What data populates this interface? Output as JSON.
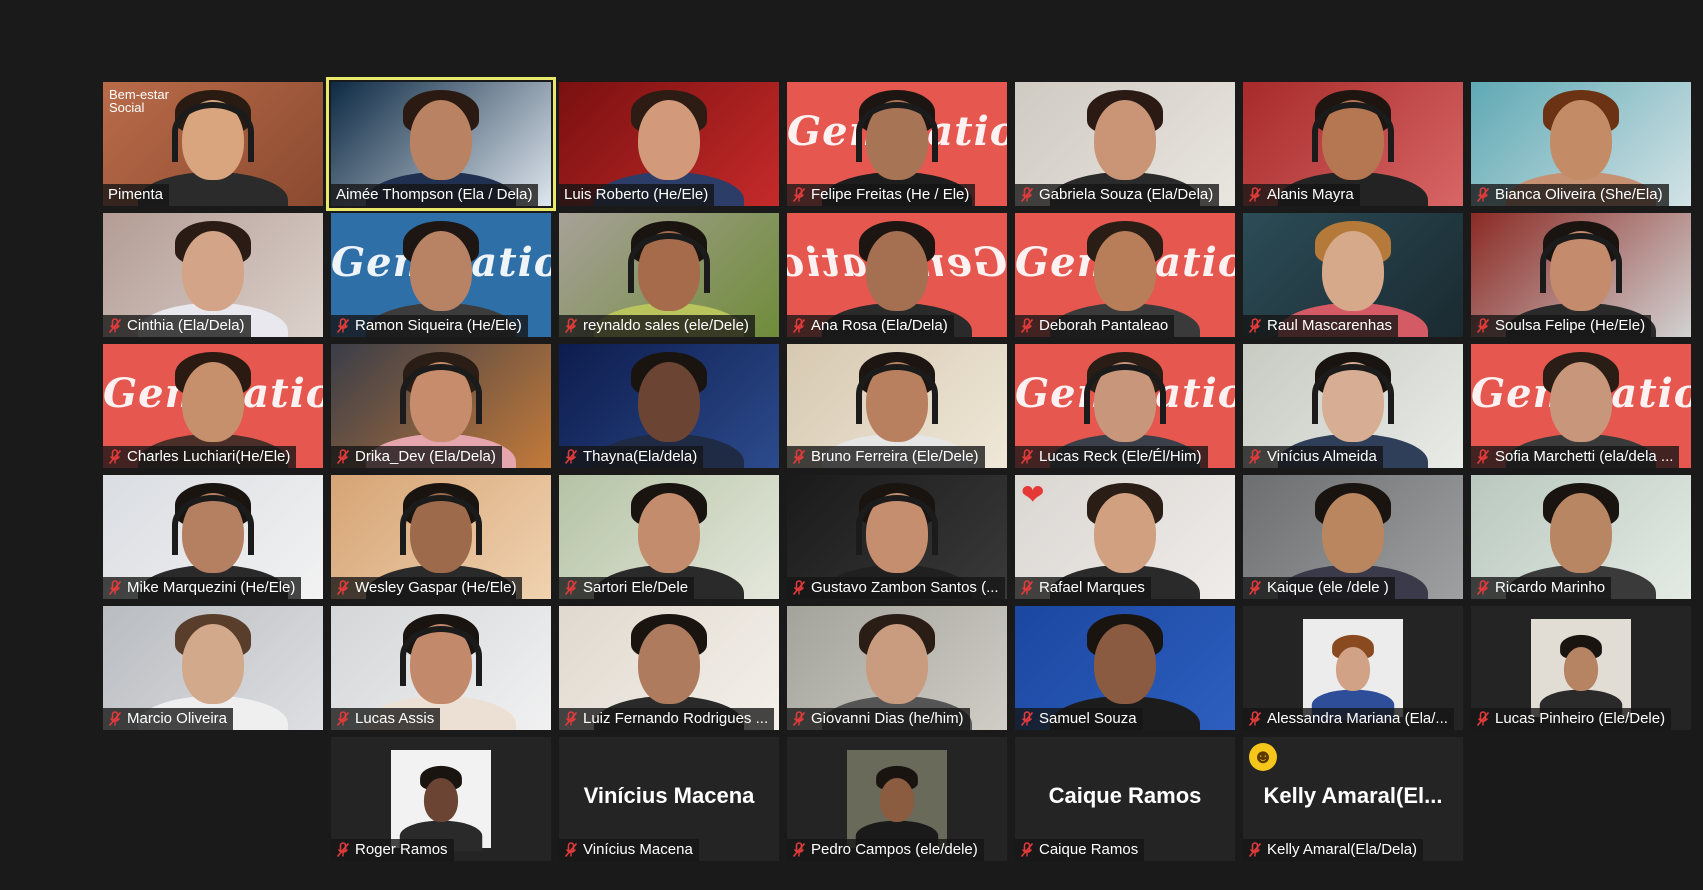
{
  "colors": {
    "background": "#1a1a1a",
    "tile_empty": "#242424",
    "active_speaker": "#e8e86a",
    "muted_icon": "#e03b3b"
  },
  "brand_text": "Generation",
  "rows": [
    [
      {
        "name": "Pimenta",
        "muted": false,
        "overlay_text": "Bem-estar Social",
        "bg": "#b96b49",
        "accent": "#8b4a30",
        "skin": "#d8a57f",
        "hair": "#2a1b12",
        "shirt": "#2b2b2b",
        "headset": true
      },
      {
        "name": "Aimée Thompson (Ela / Dela)",
        "muted": false,
        "active": true,
        "bg": "#0d2a44",
        "accent": "#dfe6ee",
        "skin": "#b98262",
        "hair": "#2a1a12",
        "shirt": "#203050"
      },
      {
        "name": "Luis Roberto (He/Ele)",
        "muted": false,
        "bg": "#7a1010",
        "accent": "#c62a2a",
        "skin": "#d29a7b",
        "hair": "#2c1c14",
        "shirt": "#2c3d68"
      },
      {
        "name": "Felipe Freitas (He / Ele)",
        "muted": true,
        "bg": "#e5574f",
        "brand": true,
        "skin": "#a87456",
        "hair": "#1d1511",
        "shirt": "#1d1d1d",
        "headset": true
      },
      {
        "name": "Gabriela Souza (Ela/Dela)",
        "muted": true,
        "bg": "#cfcac2",
        "accent": "#e9e6e0",
        "skin": "#c99576",
        "hair": "#2b1a13",
        "shirt": "#2a2a2a"
      },
      {
        "name": "Alanis Mayra",
        "muted": true,
        "bg": "#a82a2a",
        "accent": "#d86666",
        "skin": "#b57652",
        "hair": "#1e1410",
        "shirt": "#232323",
        "headset": true
      },
      {
        "name": "Bianca Oliveira (She/Ela)",
        "muted": true,
        "bg": "#5fa9b4",
        "accent": "#d3e3e6",
        "skin": "#c38c66",
        "hair": "#6b3214",
        "shirt": "#c69072"
      }
    ],
    [
      {
        "name": "Cinthia (Ela/Dela)",
        "muted": true,
        "bg": "#b39c94",
        "accent": "#dcd2cc",
        "skin": "#d3a487",
        "hair": "#2a1b14",
        "shirt": "#e8e8ee"
      },
      {
        "name": "Ramon Siqueira (He/Ele)",
        "muted": true,
        "bg": "#2e6fa8",
        "brand": true,
        "skin": "#b88364",
        "hair": "#1d1612",
        "shirt": "#3c3c3c"
      },
      {
        "name": "reynaldo sales (ele/Dele)",
        "muted": true,
        "bg": "#a7a198",
        "accent": "#6f8c39",
        "skin": "#a56b4b",
        "hair": "#1a1410",
        "shirt": "#b9c45c",
        "headset": true
      },
      {
        "name": "Ana Rosa (Ela/Dela)",
        "muted": true,
        "bg": "#e5574f",
        "brand": true,
        "mirror": true,
        "skin": "#a57052",
        "hair": "#1d1511",
        "shirt": "#2a2a2a"
      },
      {
        "name": "Deborah Pantaleao",
        "muted": true,
        "bg": "#e5574f",
        "brand": true,
        "skin": "#b87e5a",
        "hair": "#2a1d15",
        "shirt": "#3a3a3a"
      },
      {
        "name": "Raul Mascarenhas",
        "muted": true,
        "bg": "#2c4c57",
        "accent": "#1a2a30",
        "skin": "#d6a98a",
        "hair": "#b57a3a",
        "shirt": "#d45a66"
      },
      {
        "name": "Soulsa Felipe (He/Ele)",
        "muted": true,
        "bg": "#8b2a24",
        "accent": "#d2d2d2",
        "skin": "#c48b6c",
        "hair": "#1a1410",
        "shirt": "#2a2a2a",
        "headset": true
      }
    ],
    [
      {
        "name": "Charles Luchiari(He/Ele)",
        "muted": true,
        "bg": "#e5574f",
        "brand": true,
        "skin": "#c7906c",
        "hair": "#2a1a12",
        "shirt": "#4a2e28"
      },
      {
        "name": "Drika_Dev (Ela/Dela)",
        "muted": true,
        "bg": "#3a3d48",
        "accent": "#c37a3a",
        "skin": "#c68c6c",
        "hair": "#2a1d15",
        "shirt": "#e4a5ac",
        "headset": true
      },
      {
        "name": "Thayna(Ela/dela)",
        "muted": true,
        "bg": "#0d1c4d",
        "accent": "#2c4b8c",
        "skin": "#6b4434",
        "hair": "#1a1410",
        "shirt": "#1f2a44"
      },
      {
        "name": "Bruno Ferreira (Ele/Dele)",
        "muted": true,
        "bg": "#d7c9b1",
        "accent": "#efe7d8",
        "skin": "#b98060",
        "hair": "#1d1511",
        "shirt": "#e6e6e6",
        "headset": true
      },
      {
        "name": "Lucas Reck (Ele/Él/Him)",
        "muted": true,
        "bg": "#e5574f",
        "brand": true,
        "skin": "#c8967a",
        "hair": "#2a1d15",
        "shirt": "#3a3f4a",
        "headset": true
      },
      {
        "name": "Vinícius Almeida",
        "muted": true,
        "bg": "#c7cbc2",
        "accent": "#e9ebe7",
        "skin": "#d7ae94",
        "hair": "#1a1410",
        "shirt": "#2f3f5a",
        "headset": true
      },
      {
        "name": "Sofia Marchetti (ela/dela ...",
        "muted": true,
        "bg": "#e5574f",
        "brand": true,
        "skin": "#c8967a",
        "hair": "#2a1d15",
        "shirt": "#3a3a3a"
      }
    ],
    [
      {
        "name": "Mike Marquezini (He/Ele)",
        "muted": true,
        "bg": "#dadde2",
        "accent": "#f2f2f2",
        "skin": "#b58061",
        "hair": "#1a1410",
        "shirt": "#2a2a2a",
        "headset": true
      },
      {
        "name": "Wesley Gaspar (He/Ele)",
        "muted": true,
        "bg": "#d6a475",
        "accent": "#f0d2b0",
        "skin": "#9e6a4c",
        "hair": "#1a1410",
        "shirt": "#2a2a2a",
        "headset": true
      },
      {
        "name": "Sartori Ele/Dele",
        "muted": true,
        "bg": "#b5c3a5",
        "accent": "#e4e8dc",
        "skin": "#c38c6c",
        "hair": "#1a1410",
        "shirt": "#2a2a2a"
      },
      {
        "name": "Gustavo Zambon Santos (...",
        "muted": true,
        "bg": "#1a1a1a",
        "accent": "#3a3a3a",
        "skin": "#c58e6e",
        "hair": "#1a1410",
        "shirt": "#202020",
        "headset": true
      },
      {
        "name": "Rafael Marques",
        "muted": true,
        "reaction": "heart",
        "reaction_glyph": "❤",
        "bg": "#dad6d2",
        "accent": "#efece9",
        "skin": "#d1a081",
        "hair": "#2a1d15",
        "shirt": "#2a2a2a"
      },
      {
        "name": "Kaique (ele /dele )",
        "muted": true,
        "bg": "#6c6e70",
        "accent": "#9ea0a2",
        "skin": "#b9865f",
        "hair": "#1a1410",
        "shirt": "#3a3a4a"
      },
      {
        "name": "Ricardo Marinho",
        "muted": true,
        "bg": "#b9c8be",
        "accent": "#e4ebe5",
        "skin": "#b98664",
        "hair": "#1a1410",
        "shirt": "#3a3a3a"
      }
    ],
    [
      {
        "name": "Marcio Oliveira",
        "muted": true,
        "bg": "#b9bcc0",
        "accent": "#dedfe2",
        "skin": "#d3a98c",
        "hair": "#5a3e2c",
        "shirt": "#efefef"
      },
      {
        "name": "Lucas Assis",
        "muted": true,
        "bg": "#d4d6d8",
        "accent": "#f1f1f2",
        "skin": "#c3896b",
        "hair": "#1a1410",
        "shirt": "#ece0d4",
        "headset": true
      },
      {
        "name": "Luiz Fernando Rodrigues ...",
        "muted": true,
        "bg": "#e0d9cf",
        "accent": "#f4f0ea",
        "skin": "#ae7b5e",
        "hair": "#1a1410",
        "shirt": "#2a2a2a"
      },
      {
        "name": "Giovanni Dias (he/him)",
        "muted": true,
        "bg": "#a4a39b",
        "accent": "#cfcdc6",
        "skin": "#c99b7f",
        "hair": "#2a1d15",
        "shirt": "#555"
      },
      {
        "name": "Samuel Souza",
        "muted": true,
        "bg": "#1b47a0",
        "accent": "#2d5fc0",
        "skin": "#8a5b40",
        "hair": "#1a1410",
        "shirt": "#1c1c1c"
      },
      {
        "name": "Alessandra Mariana (Ela/...",
        "muted": true,
        "photo": true,
        "bg": "#242424",
        "accent": "#ececec",
        "skin": "#d2a286",
        "hair": "#8a4a20",
        "shirt": "#2f4e9a"
      },
      {
        "name": "Lucas Pinheiro (Ele/Dele)",
        "muted": true,
        "photo": true,
        "bg": "#242424",
        "accent": "#e2ddd4",
        "skin": "#b68363",
        "hair": "#1a1410",
        "shirt": "#2a2a2a"
      }
    ],
    [
      null,
      {
        "name": "Roger Ramos",
        "muted": true,
        "photo": true,
        "bg": "#242424",
        "accent": "#f2f2f2",
        "skin": "#6b4434",
        "hair": "#1a1410",
        "shirt": "#2a2a2a"
      },
      {
        "name": "Vinícius Macena",
        "muted": true,
        "display_name": "Vinícius Macena",
        "bg": "#242424"
      },
      {
        "name": "Pedro Campos (ele/dele)",
        "muted": true,
        "photo": true,
        "bg": "#242424",
        "accent": "#6a6a5a",
        "skin": "#8c5c40",
        "hair": "#1a1410",
        "shirt": "#1a1a1a"
      },
      {
        "name": "Caique Ramos",
        "muted": true,
        "display_name": "Caique Ramos",
        "bg": "#242424"
      },
      {
        "name": "Kelly Amaral(Ela/Dela)",
        "muted": true,
        "display_name": "Kelly  Amaral(El...",
        "reaction": "emoji",
        "reaction_glyph": "☻",
        "bg": "#242424"
      },
      null
    ]
  ]
}
